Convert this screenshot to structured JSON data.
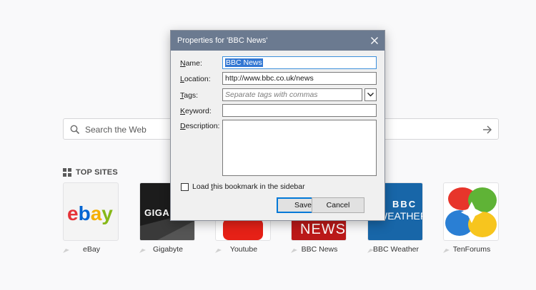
{
  "search": {
    "placeholder": "Search the Web"
  },
  "top_sites": {
    "heading": "TOP SITES",
    "tiles": [
      {
        "label": "eBay"
      },
      {
        "label": "Gigabyte",
        "thumb_text": "GIGAB"
      },
      {
        "label": "Youtube"
      },
      {
        "label": "BBC News",
        "thumb_text": "NEWS"
      },
      {
        "label": "BBC Weather",
        "thumb_line1": "BBC",
        "thumb_line2": "WEATHER"
      },
      {
        "label": "TenForums"
      }
    ]
  },
  "dialog": {
    "title": "Properties for 'BBC News'",
    "name_label_accel": "N",
    "name_label_rest": "ame:",
    "name_value": "BBC News",
    "location_label_accel": "L",
    "location_label_rest": "ocation:",
    "location_value": "http://www.bbc.co.uk/news",
    "tags_label_accel": "T",
    "tags_label_rest": "ags:",
    "tags_placeholder": "Separate tags with commas",
    "keyword_label_accel": "K",
    "keyword_label_rest": "eyword:",
    "keyword_value": "",
    "description_label_accel": "D",
    "description_label_rest": "escription:",
    "description_value": "",
    "sidebar_checkbox_pre": "Load ",
    "sidebar_checkbox_accel": "t",
    "sidebar_checkbox_post": "his bookmark in the sidebar",
    "save_label": "Save",
    "cancel_label": "Cancel"
  },
  "colors": {
    "titlebar": "#6b7a90",
    "selection": "#3277d3",
    "bbc_news_red": "#bb1919",
    "bbc_weather_blue": "#1866a8"
  }
}
